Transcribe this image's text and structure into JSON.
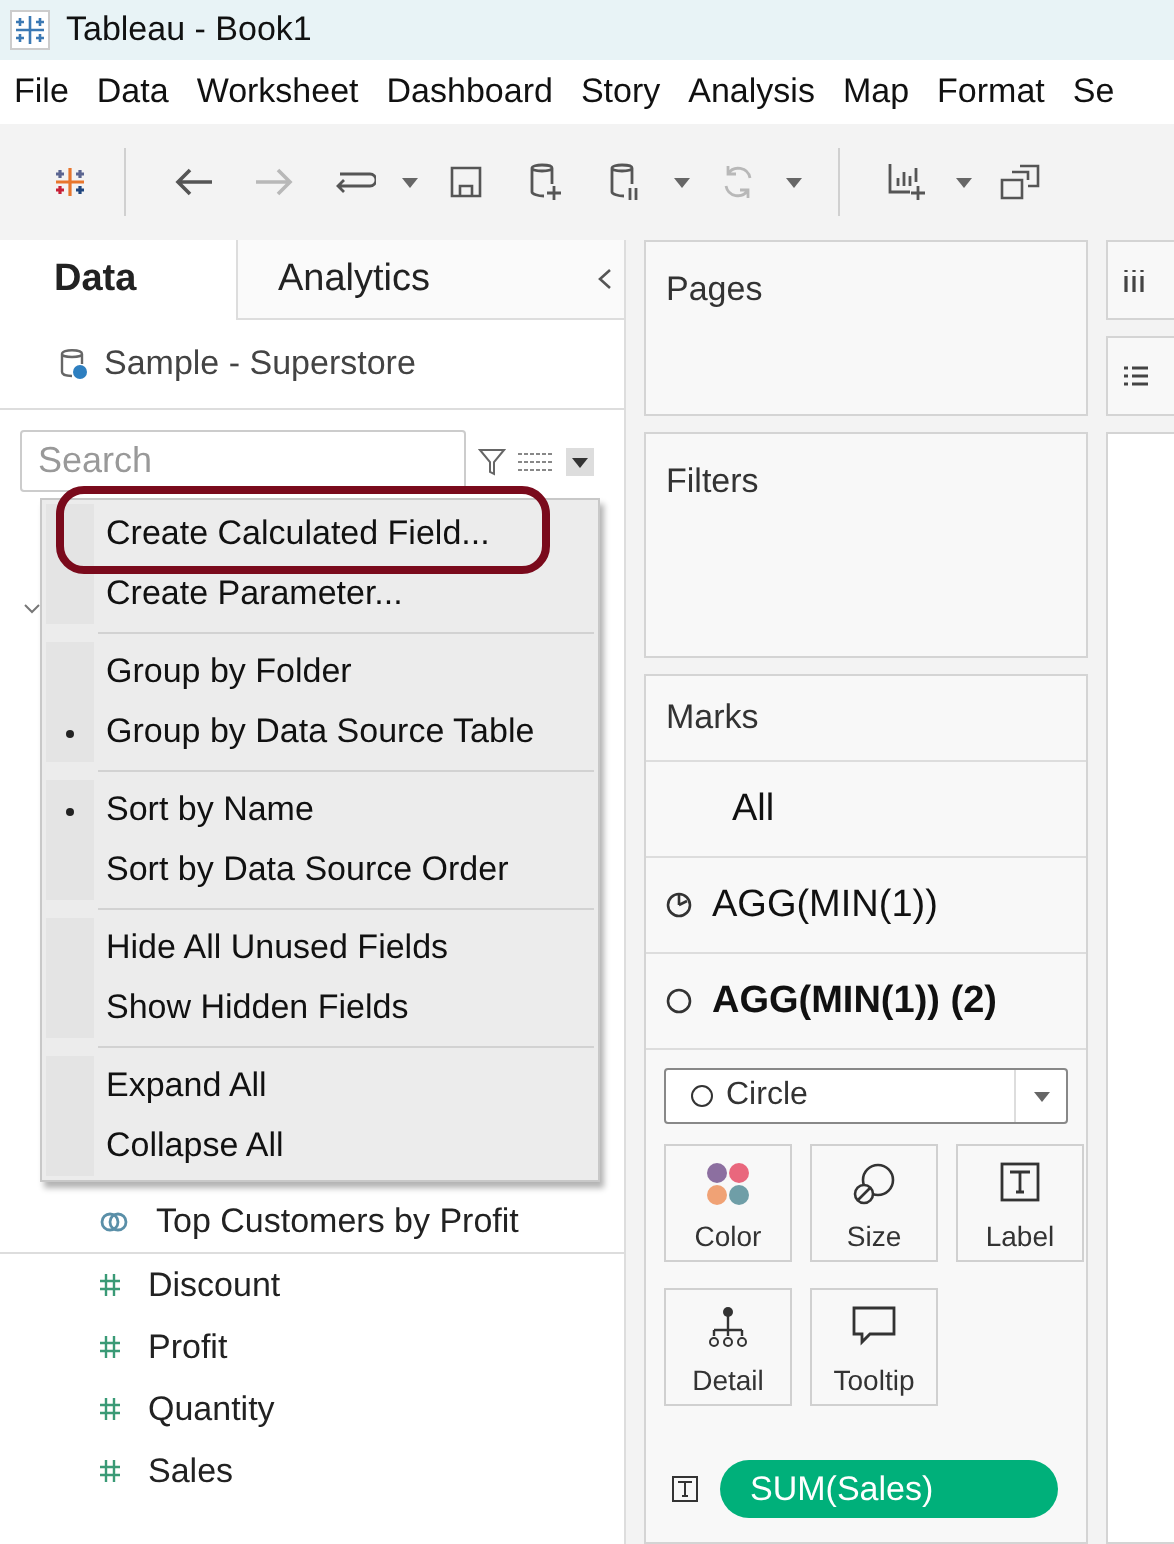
{
  "window": {
    "title": "Tableau - Book1"
  },
  "menu_bar": [
    "File",
    "Data",
    "Worksheet",
    "Dashboard",
    "Story",
    "Analysis",
    "Map",
    "Format",
    "Se"
  ],
  "toolbar": [
    {
      "disabled": false
    },
    {
      "disabled": true
    },
    {
      "disabled": false
    },
    {
      "disabled": false
    },
    {
      "disabled": false
    },
    {
      "disabled": false
    },
    {
      "disabled": true
    },
    {
      "disabled": false
    },
    {
      "disabled": false
    }
  ],
  "data_pane": {
    "tabs": [
      {
        "label": "Data",
        "selected": true
      },
      {
        "label": "Analytics",
        "selected": false
      }
    ],
    "data_source": "Sample - Superstore",
    "search": {
      "placeholder": "Search"
    },
    "fields": [
      {
        "name": "Top Customers by Profit",
        "kind": "set"
      },
      {
        "name": "Discount",
        "kind": "measure"
      },
      {
        "name": "Profit",
        "kind": "measure"
      },
      {
        "name": "Quantity",
        "kind": "measure"
      },
      {
        "name": "Sales",
        "kind": "measure"
      }
    ]
  },
  "context_menu": {
    "sections": [
      [
        {
          "label": "Create Calculated Field...",
          "checked": false,
          "annotated": true
        },
        {
          "label": "Create Parameter...",
          "checked": false,
          "annotated": false
        }
      ],
      [
        {
          "label": "Group by Folder",
          "checked": false,
          "annotated": false
        },
        {
          "label": "Group by Data Source Table",
          "checked": true,
          "annotated": false
        }
      ],
      [
        {
          "label": "Sort by Name",
          "checked": true,
          "annotated": false
        },
        {
          "label": "Sort by Data Source Order",
          "checked": false,
          "annotated": false
        }
      ],
      [
        {
          "label": "Hide All Unused Fields",
          "checked": false,
          "annotated": false
        },
        {
          "label": "Show Hidden Fields",
          "checked": false,
          "annotated": false
        }
      ],
      [
        {
          "label": "Expand All",
          "checked": false,
          "annotated": false
        },
        {
          "label": "Collapse All",
          "checked": false,
          "annotated": false
        }
      ]
    ]
  },
  "pages": {
    "title": "Pages"
  },
  "filters": {
    "title": "Filters"
  },
  "marks": {
    "title": "Marks",
    "layers": [
      {
        "label": "All",
        "kind": "all",
        "selected": false
      },
      {
        "label": "AGG(MIN(1))",
        "kind": "pie",
        "selected": false
      },
      {
        "label": "AGG(MIN(1)) (2)",
        "kind": "circle",
        "selected": true
      }
    ],
    "mark_type": "Circle",
    "buttons": [
      "Color",
      "Size",
      "Label",
      "Detail",
      "Tooltip"
    ],
    "pills": [
      {
        "label": "SUM(Sales)"
      }
    ]
  }
}
